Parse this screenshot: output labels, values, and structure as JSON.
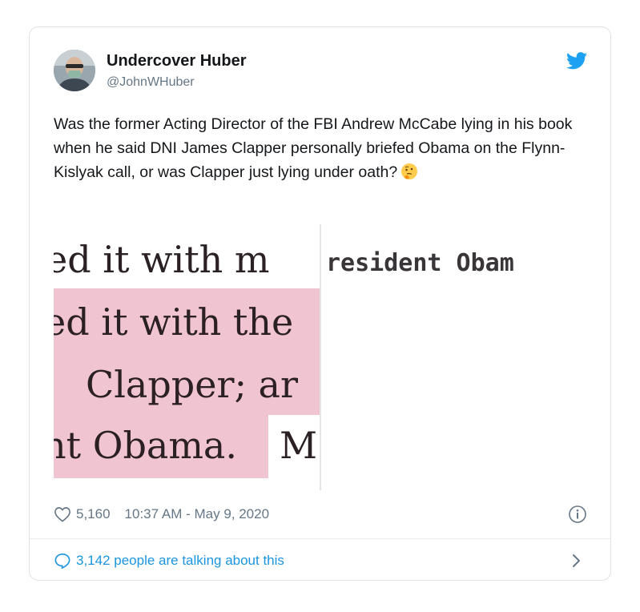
{
  "tweet": {
    "display_name": "Undercover Huber",
    "handle": "@JohnWHuber",
    "text": "Was the former Acting Director of the FBI Andrew McCabe lying in his book when he said DNI James Clapper personally briefed Obama on the Flynn-Kislyak call, or was Clapper just lying under oath?",
    "emoji_icon": "thinking-face-emoji",
    "likes": "5,160",
    "timestamp": "10:37 AM - May 9, 2020",
    "talking": "3,142 people are talking about this"
  },
  "media": {
    "line1": "ed it with m",
    "line1_overlay": "resident Obam",
    "line2": "ed it with the",
    "line3": "Clapper;  ar",
    "line4": "nt Obama.",
    "line4_tail": "M",
    "highlight_color": "#f1c4d1"
  },
  "colors": {
    "accent": "#1da1f2",
    "link": "#1b95e0",
    "secondary": "#657786"
  },
  "icons": {
    "brand": "twitter-bird-icon",
    "like": "heart-outline-icon",
    "info": "info-circle-icon",
    "reply": "speech-bubble-icon",
    "chevron": "chevron-right-icon"
  }
}
